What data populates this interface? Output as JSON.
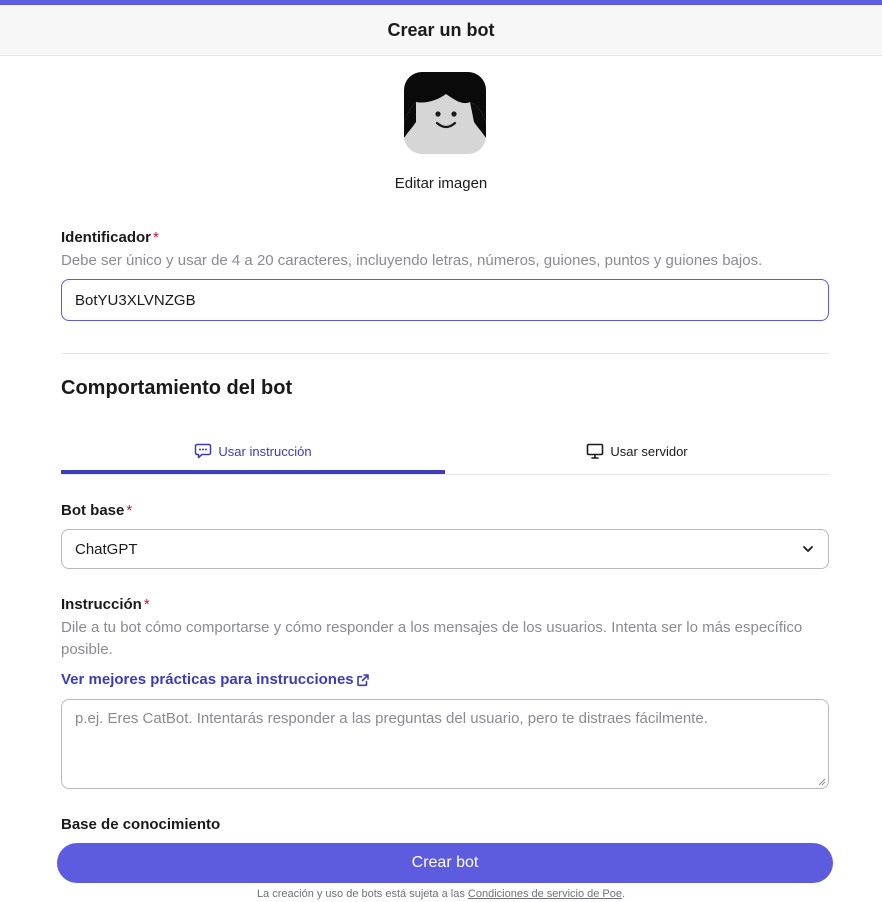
{
  "header": {
    "title": "Crear un bot"
  },
  "avatar": {
    "edit_label": "Editar imagen"
  },
  "identifier": {
    "label": "Identificador",
    "required_mark": "*",
    "hint": "Debe ser único y usar de 4 a 20 caracteres, incluyendo letras, números, guiones, puntos y guiones bajos.",
    "value": "BotYU3XLVNZGB"
  },
  "behavior": {
    "title": "Comportamiento del bot",
    "tabs": [
      {
        "label": "Usar instrucción",
        "icon": "chat-bubble-icon",
        "active": true
      },
      {
        "label": "Usar servidor",
        "icon": "monitor-icon",
        "active": false
      }
    ]
  },
  "base_bot": {
    "label": "Bot base",
    "required_mark": "*",
    "value": "ChatGPT"
  },
  "instruction": {
    "label": "Instrucción",
    "required_mark": "*",
    "hint": "Dile a tu bot cómo comportarse y cómo responder a los mensajes de los usuarios. Intenta ser lo más específico posible.",
    "link": "Ver mejores prácticas para instrucciones",
    "placeholder": "p.ej. Eres CatBot. Intentarás responder a las preguntas del usuario, pero te distraes fácilmente."
  },
  "knowledge": {
    "label": "Base de conocimiento"
  },
  "actions": {
    "create_label": "Crear bot"
  },
  "footer": {
    "text": "La creación y uso de bots está sujeta a las ",
    "link": "Condiciones de servicio de Poe",
    "suffix": "."
  },
  "colors": {
    "accent": "#5d5cde",
    "accent_text": "#3c3cb8",
    "required": "#c8102e"
  }
}
